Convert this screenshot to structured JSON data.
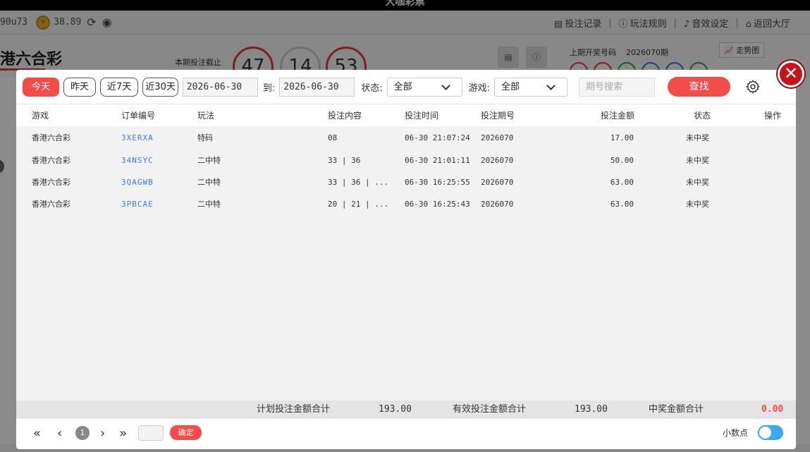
{
  "app": {
    "header_title": "大咖彩票",
    "username": "90u73",
    "balance": "38.89",
    "top_links": [
      {
        "label": "投注记录"
      },
      {
        "label": "玩法规则"
      },
      {
        "label": "音效设定"
      },
      {
        "label": "返回大厅"
      }
    ],
    "game_title": "港六合彩",
    "deadline_label": "本期投注截止",
    "timer": [
      "47",
      "14",
      "53"
    ],
    "last_draw_label": "上期开奖号码",
    "last_draw_period": "2026070期",
    "trend_label": "走势图"
  },
  "modal": {
    "filters": {
      "quick_ranges": [
        "今天",
        "昨天",
        "近7天",
        "近30天"
      ],
      "active_range": 0,
      "date_from": "2026-06-30",
      "to_label": "到:",
      "date_to": "2026-06-30",
      "status_label": "状态:",
      "status_value": "全部",
      "game_label": "游戏:",
      "game_value": "全部",
      "period_placeholder": "期号搜索",
      "search_label": "查找"
    },
    "table": {
      "headers": [
        "游戏",
        "订单编号",
        "玩法",
        "投注内容",
        "投注时间",
        "投注期号",
        "投注金额",
        "状态",
        "操作"
      ],
      "rows": [
        {
          "game": "香港六合彩",
          "order": "3XERXA",
          "play": "特码",
          "content": "08",
          "time": "06-30 21:07:24",
          "period": "2026070",
          "amount": "17.00",
          "status": "未中奖"
        },
        {
          "game": "香港六合彩",
          "order": "34NSYC",
          "play": "二中特",
          "content": "33 | 36",
          "time": "06-30 21:01:11",
          "period": "2026070",
          "amount": "50.00",
          "status": "未中奖"
        },
        {
          "game": "香港六合彩",
          "order": "3QAGWB",
          "play": "二中特",
          "content": "33 | 36 | ...",
          "time": "06-30 16:25:55",
          "period": "2026070",
          "amount": "63.00",
          "status": "未中奖"
        },
        {
          "game": "香港六合彩",
          "order": "3PBCAE",
          "play": "二中特",
          "content": "20 | 21 | ...",
          "time": "06-30 16:25:43",
          "period": "2026070",
          "amount": "63.00",
          "status": "未中奖"
        }
      ]
    },
    "summary": {
      "planned_label": "计划投注金额合计",
      "planned_value": "193.00",
      "valid_label": "有效投注金额合计",
      "valid_value": "193.00",
      "win_label": "中奖金额合计",
      "win_value": "0.00"
    },
    "pager": {
      "current_page": "1",
      "confirm_label": "确定",
      "decimal_label": "小数点",
      "decimal_on": true
    }
  },
  "colors": {
    "accent_red": "#f44b4b",
    "link_blue": "#3e7ae0",
    "toggle_blue": "#3ea7f5",
    "close_red": "#c4151c"
  },
  "icons": [
    "coin-icon",
    "refresh-icon",
    "eye-icon",
    "document-icon",
    "info-icon",
    "music-note-icon",
    "home-icon",
    "chart-icon",
    "chevron-down-icon",
    "gear-icon",
    "close-icon",
    "first-page-icon",
    "prev-page-icon",
    "next-page-icon",
    "last-page-icon"
  ]
}
